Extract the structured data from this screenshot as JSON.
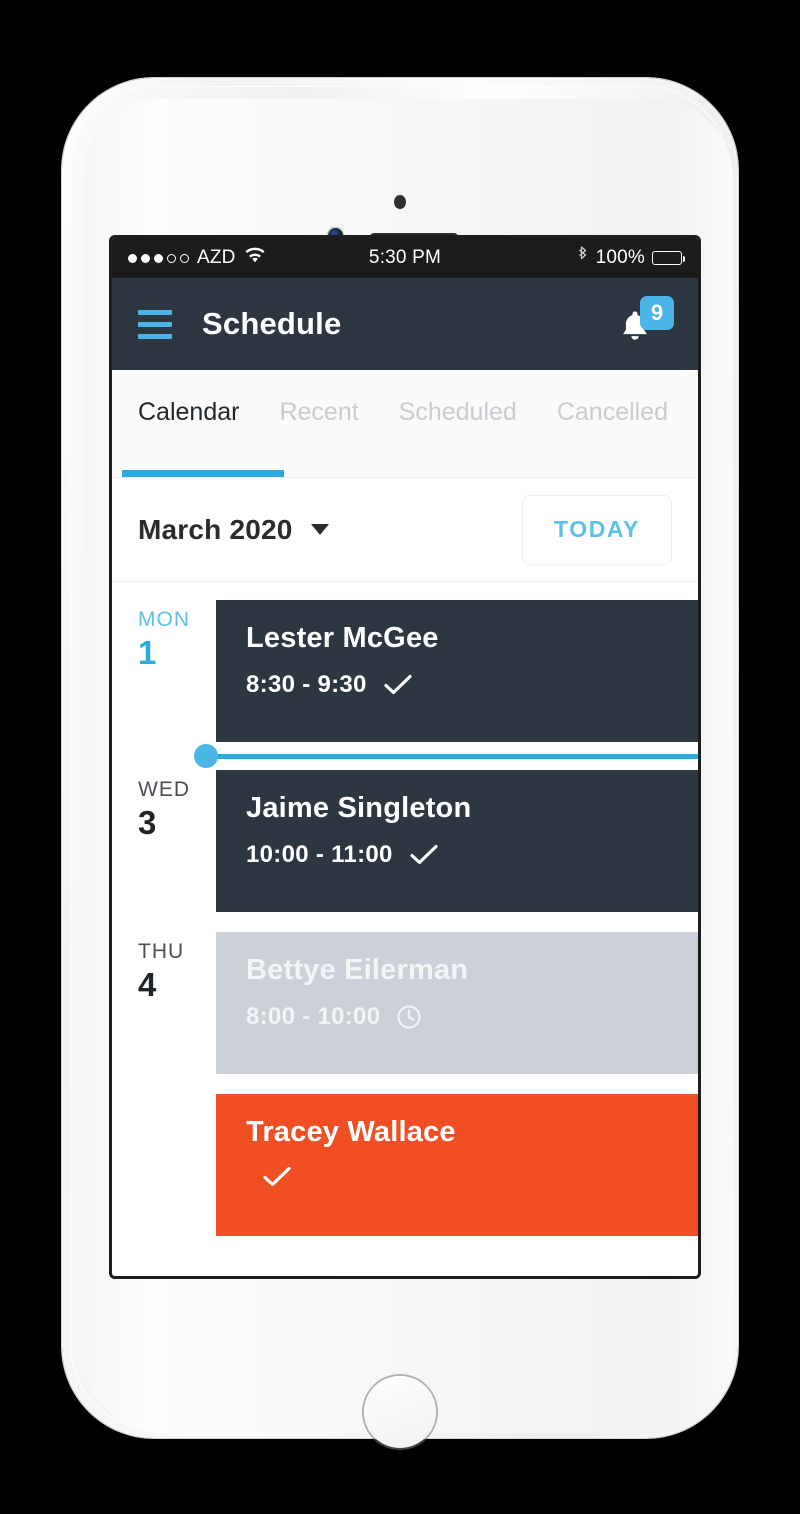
{
  "status_bar": {
    "signal_filled": 3,
    "signal_empty": 2,
    "carrier": "AZD",
    "wifi_icon": "wifi-icon",
    "time": "5:30 PM",
    "bluetooth_icon": "bluetooth-icon",
    "battery_pct": "100%",
    "battery_level": 100
  },
  "nav": {
    "menu_icon": "hamburger-menu-icon",
    "title": "Schedule",
    "bell_icon": "notification-bell-icon",
    "badge_count": "9"
  },
  "tabs": [
    {
      "label": "Calendar",
      "active": true
    },
    {
      "label": "Recent",
      "active": false
    },
    {
      "label": "Scheduled",
      "active": false
    },
    {
      "label": "Cancelled",
      "active": false
    }
  ],
  "month_bar": {
    "month_label": "March 2020",
    "caret_icon": "chevron-down-icon",
    "today_label": "TODAY"
  },
  "events": [
    {
      "weekday": "MON",
      "day": "1",
      "is_today": true,
      "name": "Lester McGee",
      "time": "8:30 - 9:30",
      "status_icon": "checkmark-icon",
      "style": "dark"
    },
    {
      "weekday": "WED",
      "day": "3",
      "is_today": false,
      "name": "Jaime Singleton",
      "time": "10:00 - 11:00",
      "status_icon": "checkmark-icon",
      "style": "dark"
    },
    {
      "weekday": "THU",
      "day": "4",
      "is_today": false,
      "name": "Bettye Eilerman",
      "time": "8:00 - 10:00",
      "status_icon": "clock-icon",
      "style": "muted"
    },
    {
      "weekday": "",
      "day": "",
      "is_today": false,
      "name": "Tracey Wallace",
      "time": "",
      "status_icon": "checkmark-icon",
      "style": "orange"
    }
  ],
  "now_indicator": {
    "label": "current-time-indicator",
    "accent_color": "#29abe2"
  },
  "colors": {
    "nav_background": "#2c3742",
    "accent_blue": "#29abe2",
    "light_blue": "#4ab6e8",
    "card_dark": "#2c3742",
    "card_muted": "#ccd1d9",
    "card_orange": "#f04e23",
    "status_bar": "#1c1c1c"
  }
}
